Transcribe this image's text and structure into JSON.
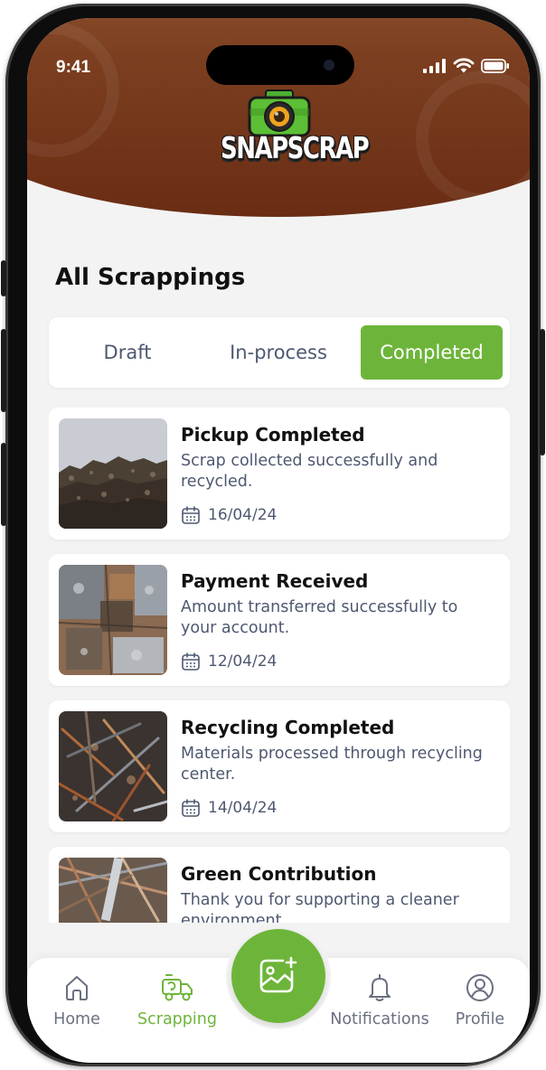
{
  "status_bar": {
    "time": "9:41"
  },
  "header": {
    "brand": "SNAPSCRAP"
  },
  "page": {
    "title": "All Scrappings"
  },
  "tabs": [
    {
      "label": "Draft",
      "active": false
    },
    {
      "label": "In-process",
      "active": false
    },
    {
      "label": "Completed",
      "active": true
    }
  ],
  "cards": [
    {
      "title": "Pickup Completed",
      "description": "Scrap collected successfully and recycled.",
      "date": "16/04/24"
    },
    {
      "title": "Payment Received",
      "description": "Amount transferred successfully to your account.",
      "date": "12/04/24"
    },
    {
      "title": "Recycling Completed",
      "description": "Materials processed through recycling center.",
      "date": "14/04/24"
    },
    {
      "title": "Green Contribution",
      "description": "Thank you for supporting a cleaner environment.",
      "date": ""
    }
  ],
  "bottom_nav": {
    "items": [
      {
        "label": "Home",
        "icon": "home-icon",
        "active": false
      },
      {
        "label": "Scrapping",
        "icon": "recycle-truck-icon",
        "active": true
      },
      {
        "label": "Notifications",
        "icon": "bell-icon",
        "active": false
      },
      {
        "label": "Profile",
        "icon": "user-circle-icon",
        "active": false
      }
    ],
    "fab_icon": "add-photo-icon"
  },
  "colors": {
    "accent": "#6db53a",
    "header_brown": "#7c3f20",
    "text_primary": "#111111",
    "text_secondary": "#4e5870",
    "background": "#f3f3f3"
  }
}
